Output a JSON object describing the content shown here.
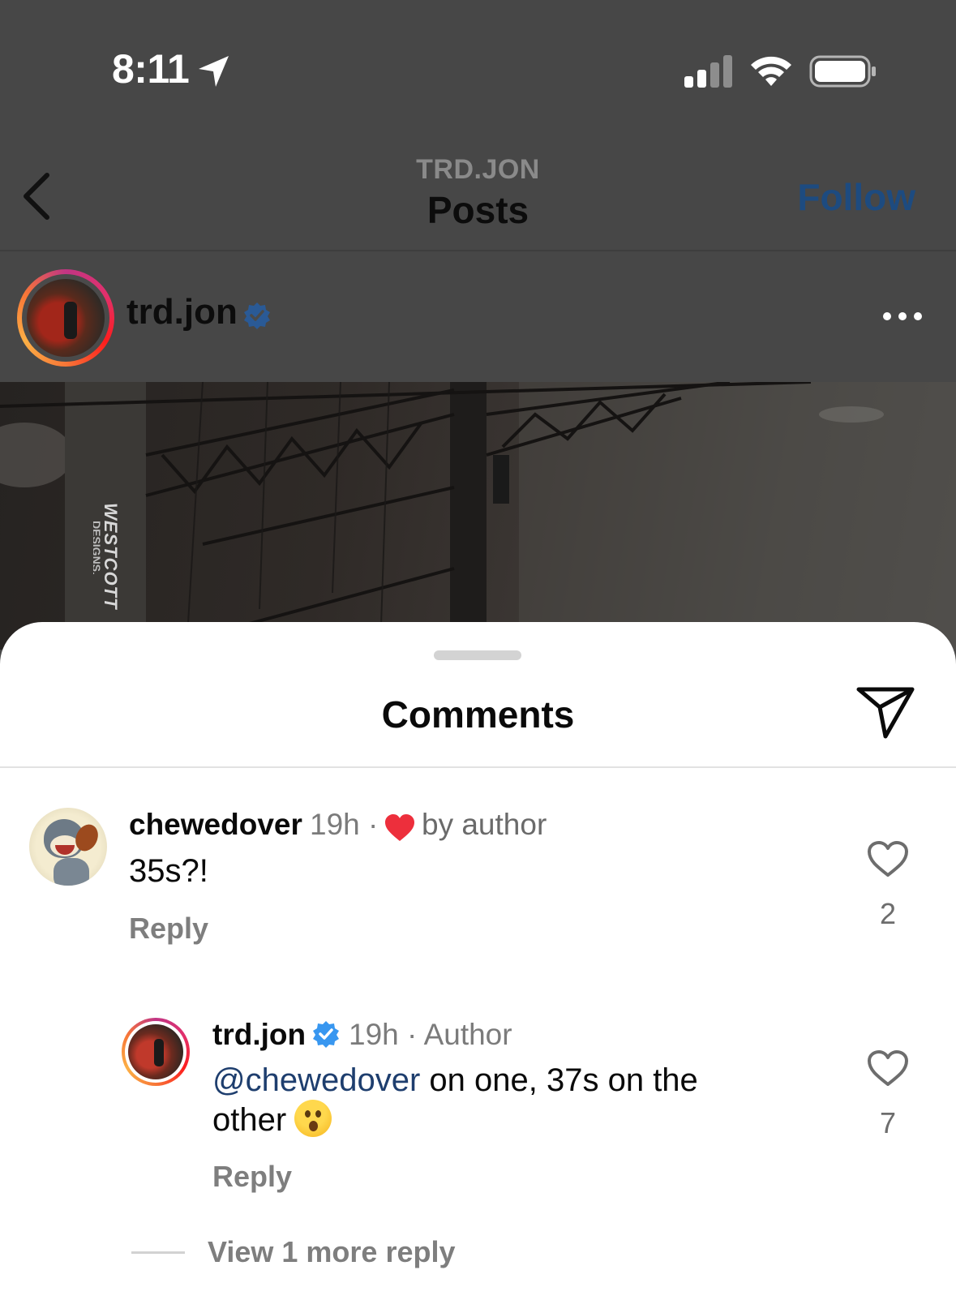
{
  "status_bar": {
    "time": "8:11",
    "icons": [
      "location-arrow-icon",
      "cellular-signal-icon",
      "wifi-icon",
      "battery-icon"
    ]
  },
  "header": {
    "account": "TRD.JON",
    "title": "Posts",
    "follow_label": "Follow",
    "back_icon": "chevron-left-icon"
  },
  "post": {
    "username": "trd.jon",
    "verified": true,
    "more_icon": "more-horizontal-icon",
    "image_sign_text": "WESTCOTT",
    "image_sign_subtext": "DESIGNS."
  },
  "comments_sheet": {
    "title": "Comments",
    "share_icon": "paper-plane-icon",
    "comments": [
      {
        "username": "chewedover",
        "time": "19h",
        "separator": "·",
        "liked_by_author_label": "by author",
        "text": "35s?!",
        "reply_label": "Reply",
        "like_count": "2"
      },
      {
        "username": "trd.jon",
        "verified": true,
        "meta": "19h · Author",
        "mention": "@chewedover",
        "text": " on one, 37s on the other",
        "emoji": "hushed-face",
        "reply_label": "Reply",
        "like_count": "7"
      }
    ],
    "view_more_label": "View 1 more reply"
  },
  "colors": {
    "follow": "#1d4b80",
    "verified_badge": "#3897f0",
    "liked_heart": "#ed2f3c",
    "mention": "#1e3e6e",
    "overlay": "#474747"
  }
}
